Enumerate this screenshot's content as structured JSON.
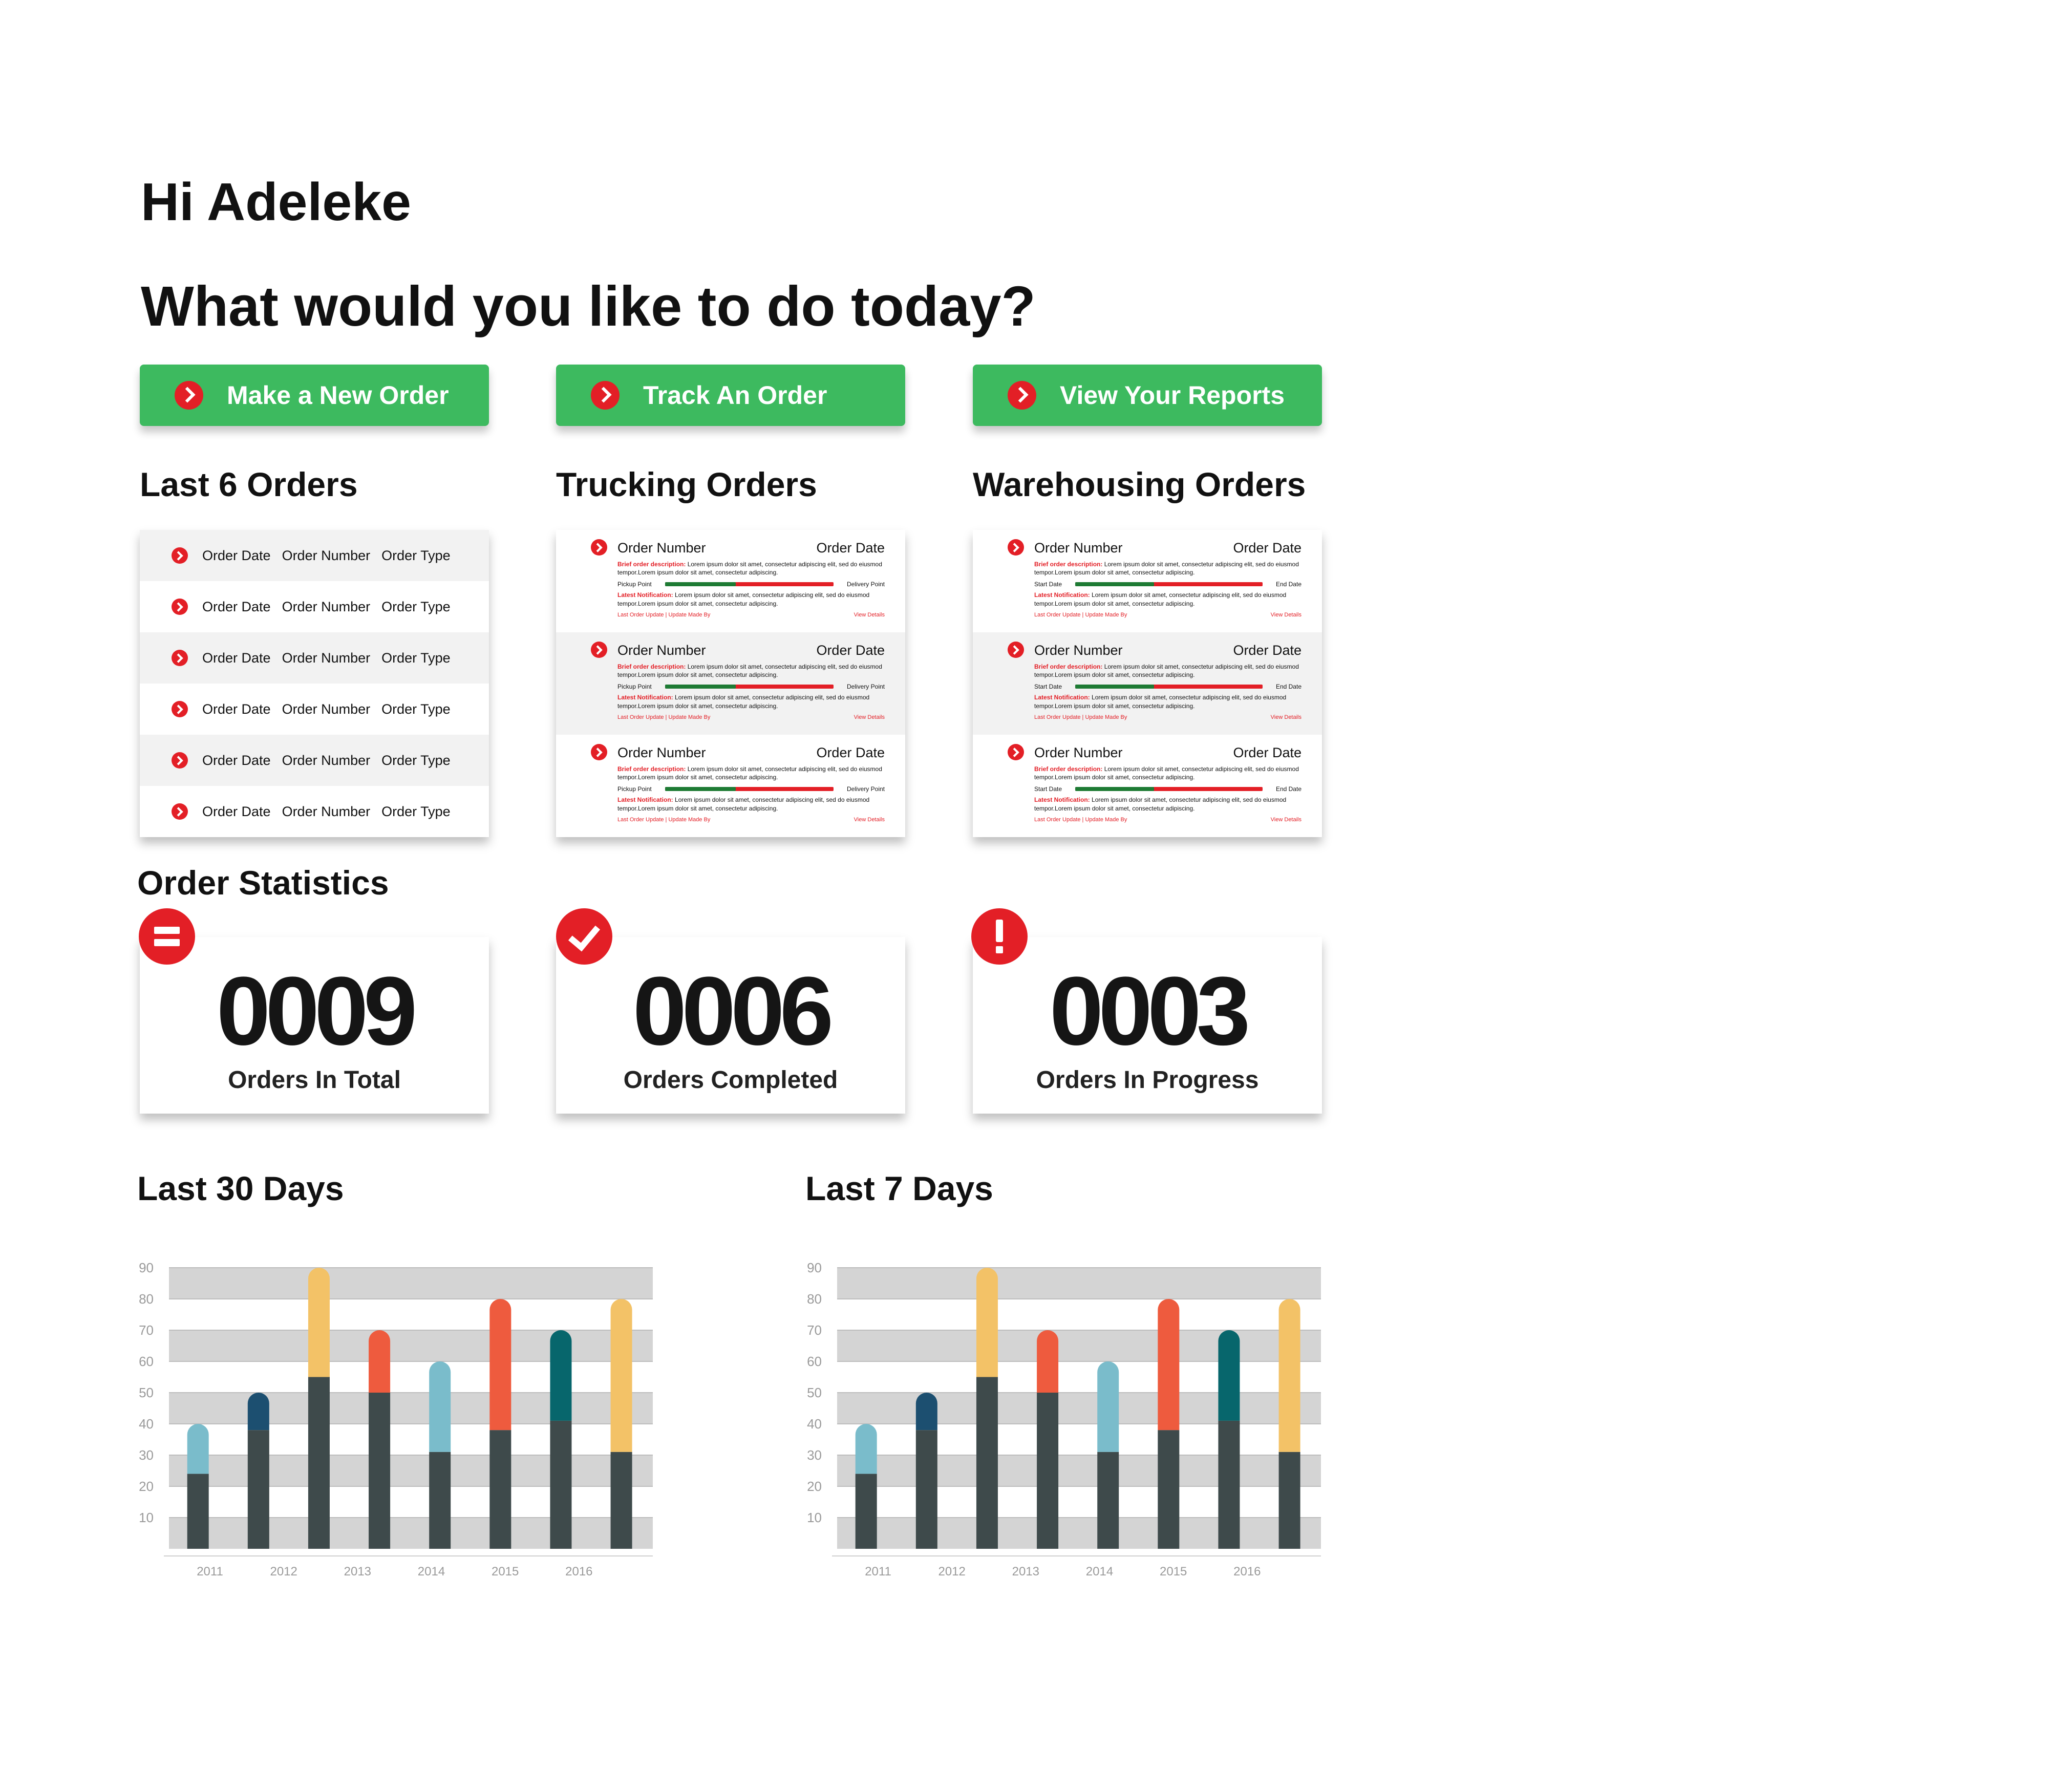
{
  "greeting": "Hi Adeleke",
  "question": "What would you like to do today?",
  "actions": {
    "new_order": "Make a New Order",
    "track_order": "Track An Order",
    "reports": "View Your Reports"
  },
  "sections": {
    "last_orders": "Last 6 Orders",
    "trucking": "Trucking Orders",
    "warehousing": "Warehousing Orders",
    "statistics": "Order Statistics",
    "last30": "Last 30 Days",
    "last7": "Last 7 Days"
  },
  "last_orders": {
    "rows": [
      {
        "date": "Order Date",
        "number": "Order Number",
        "type": "Order Type"
      },
      {
        "date": "Order Date",
        "number": "Order Number",
        "type": "Order Type"
      },
      {
        "date": "Order Date",
        "number": "Order Number",
        "type": "Order Type"
      },
      {
        "date": "Order Date",
        "number": "Order Number",
        "type": "Order Type"
      },
      {
        "date": "Order Date",
        "number": "Order Number",
        "type": "Order Type"
      },
      {
        "date": "Order Date",
        "number": "Order Number",
        "type": "Order Type"
      }
    ]
  },
  "trucking": {
    "cards": [
      {
        "number": "Order Number",
        "date": "Order Date",
        "desc_label": "Brief order description:",
        "desc": "Lorem ipsum dolor sit amet, consectetur adipiscing elit, sed do eiusmod tempor.Lorem ipsum dolor sit amet, consectetur adipiscing.",
        "start": "Pickup Point",
        "end": "Delivery Point",
        "progress": 0.42,
        "notif_label": "Latest Notification:",
        "notif": "Lorem ipsum dolor sit amet, consectetur adipiscing elit, sed do eiusmod tempor.Lorem ipsum dolor sit amet, consectetur adipiscing.",
        "update": "Last Order Update | Update Made By",
        "view": "View Details"
      },
      {
        "number": "Order Number",
        "date": "Order Date",
        "desc_label": "Brief order description:",
        "desc": "Lorem ipsum dolor sit amet, consectetur adipiscing elit, sed do eiusmod tempor.Lorem ipsum dolor sit amet, consectetur adipiscing.",
        "start": "Pickup Point",
        "end": "Delivery Point",
        "progress": 0.42,
        "notif_label": "Latest Notification:",
        "notif": "Lorem ipsum dolor sit amet, consectetur adipiscing elit, sed do eiusmod tempor.Lorem ipsum dolor sit amet, consectetur adipiscing.",
        "update": "Last Order Update | Update Made By",
        "view": "View Details"
      },
      {
        "number": "Order Number",
        "date": "Order Date",
        "desc_label": "Brief order description:",
        "desc": "Lorem ipsum dolor sit amet, consectetur adipiscing elit, sed do eiusmod tempor.Lorem ipsum dolor sit amet, consectetur adipiscing.",
        "start": "Pickup Point",
        "end": "Delivery Point",
        "progress": 0.42,
        "notif_label": "Latest Notification:",
        "notif": "Lorem ipsum dolor sit amet, consectetur adipiscing elit, sed do eiusmod tempor.Lorem ipsum dolor sit amet, consectetur adipiscing.",
        "update": "Last Order Update | Update Made By",
        "view": "View Details"
      }
    ]
  },
  "warehousing": {
    "cards": [
      {
        "number": "Order Number",
        "date": "Order Date",
        "desc_label": "Brief order description:",
        "desc": "Lorem ipsum dolor sit amet, consectetur adipiscing elit, sed do eiusmod tempor.Lorem ipsum dolor sit amet, consectetur adipiscing.",
        "start": "Start Date",
        "end": "End Date",
        "progress": 0.42,
        "notif_label": "Latest Notification:",
        "notif": "Lorem ipsum dolor sit amet, consectetur adipiscing elit, sed do eiusmod tempor.Lorem ipsum dolor sit amet, consectetur adipiscing.",
        "update": "Last Order Update | Update Made By",
        "view": "View Details"
      },
      {
        "number": "Order Number",
        "date": "Order Date",
        "desc_label": "Brief order description:",
        "desc": "Lorem ipsum dolor sit amet, consectetur adipiscing elit, sed do eiusmod tempor.Lorem ipsum dolor sit amet, consectetur adipiscing.",
        "start": "Start Date",
        "end": "End Date",
        "progress": 0.42,
        "notif_label": "Latest Notification:",
        "notif": "Lorem ipsum dolor sit amet, consectetur adipiscing elit, sed do eiusmod tempor.Lorem ipsum dolor sit amet, consectetur adipiscing.",
        "update": "Last Order Update | Update Made By",
        "view": "View Details"
      },
      {
        "number": "Order Number",
        "date": "Order Date",
        "desc_label": "Brief order description:",
        "desc": "Lorem ipsum dolor sit amet, consectetur adipiscing elit, sed do eiusmod tempor.Lorem ipsum dolor sit amet, consectetur adipiscing.",
        "start": "Start Date",
        "end": "End Date",
        "progress": 0.42,
        "notif_label": "Latest Notification:",
        "notif": "Lorem ipsum dolor sit amet, consectetur adipiscing elit, sed do eiusmod tempor.Lorem ipsum dolor sit amet, consectetur adipiscing.",
        "update": "Last Order Update | Update Made By",
        "view": "View Details"
      }
    ]
  },
  "stats": {
    "total": {
      "value": "0009",
      "label": "Orders In Total",
      "icon": "equals-icon"
    },
    "completed": {
      "value": "0006",
      "label": "Orders Completed",
      "icon": "check-icon"
    },
    "in_progress": {
      "value": "0003",
      "label": "Orders In Progress",
      "icon": "exclamation-icon"
    }
  },
  "colors": {
    "accent_green": "#3dba5f",
    "accent_red": "#e31f26",
    "bar_base": "#3e4a4b",
    "light_blue": "#7abccb",
    "navy": "#1c4f70",
    "yellow": "#f3c267",
    "orange": "#ee5b3e",
    "teal": "#07666c"
  },
  "chart_data": [
    {
      "type": "bar",
      "stacked": true,
      "x_tick_labels": [
        "2011",
        "2012",
        "2013",
        "2014",
        "2015",
        "2016"
      ],
      "y_ticks": [
        10,
        20,
        30,
        40,
        50,
        60,
        70,
        80,
        90
      ],
      "ylim": [
        0,
        90
      ],
      "grid": "alternating bands",
      "bars": [
        {
          "base": 24,
          "total": 40,
          "color": "#7abccb"
        },
        {
          "base": 38,
          "total": 50,
          "color": "#1c4f70"
        },
        {
          "base": 55,
          "total": 90,
          "color": "#f3c267"
        },
        {
          "base": 50,
          "total": 70,
          "color": "#ee5b3e"
        },
        {
          "base": 31,
          "total": 60,
          "color": "#7abccb"
        },
        {
          "base": 38,
          "total": 80,
          "color": "#ee5b3e"
        },
        {
          "base": 41,
          "total": 70,
          "color": "#07666c"
        },
        {
          "base": 31,
          "total": 80,
          "color": "#f3c267"
        }
      ]
    },
    {
      "type": "bar",
      "stacked": true,
      "x_tick_labels": [
        "2011",
        "2012",
        "2013",
        "2014",
        "2015",
        "2016"
      ],
      "y_ticks": [
        10,
        20,
        30,
        40,
        50,
        60,
        70,
        80,
        90
      ],
      "ylim": [
        0,
        90
      ],
      "grid": "alternating bands",
      "bars": [
        {
          "base": 24,
          "total": 40,
          "color": "#7abccb"
        },
        {
          "base": 38,
          "total": 50,
          "color": "#1c4f70"
        },
        {
          "base": 55,
          "total": 90,
          "color": "#f3c267"
        },
        {
          "base": 50,
          "total": 70,
          "color": "#ee5b3e"
        },
        {
          "base": 31,
          "total": 60,
          "color": "#7abccb"
        },
        {
          "base": 38,
          "total": 80,
          "color": "#ee5b3e"
        },
        {
          "base": 41,
          "total": 70,
          "color": "#07666c"
        },
        {
          "base": 31,
          "total": 80,
          "color": "#f3c267"
        }
      ]
    }
  ]
}
